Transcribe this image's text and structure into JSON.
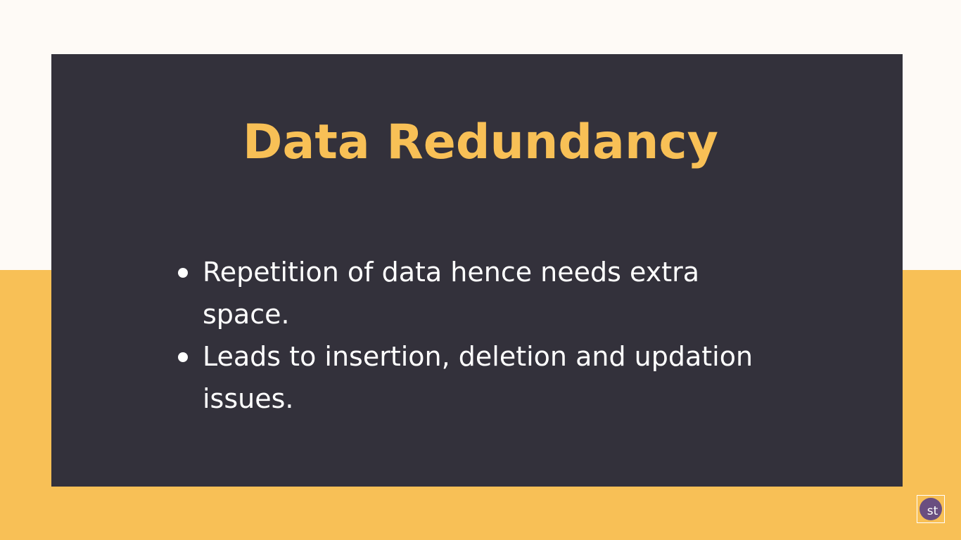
{
  "slide": {
    "title": "Data Redundancy",
    "bullets": [
      "Repetition of data hence needs extra space.",
      "Leads to insertion, deletion and updation issues."
    ]
  },
  "watermark": {
    "text": "st",
    "icon": "logo-icon"
  },
  "colors": {
    "background_top": "#fefaf6",
    "background_bottom": "#f8c056",
    "card": "#33313b",
    "title": "#f8c056",
    "bullet_text": "#ffffff",
    "logo_circle": "#6a4e80"
  }
}
